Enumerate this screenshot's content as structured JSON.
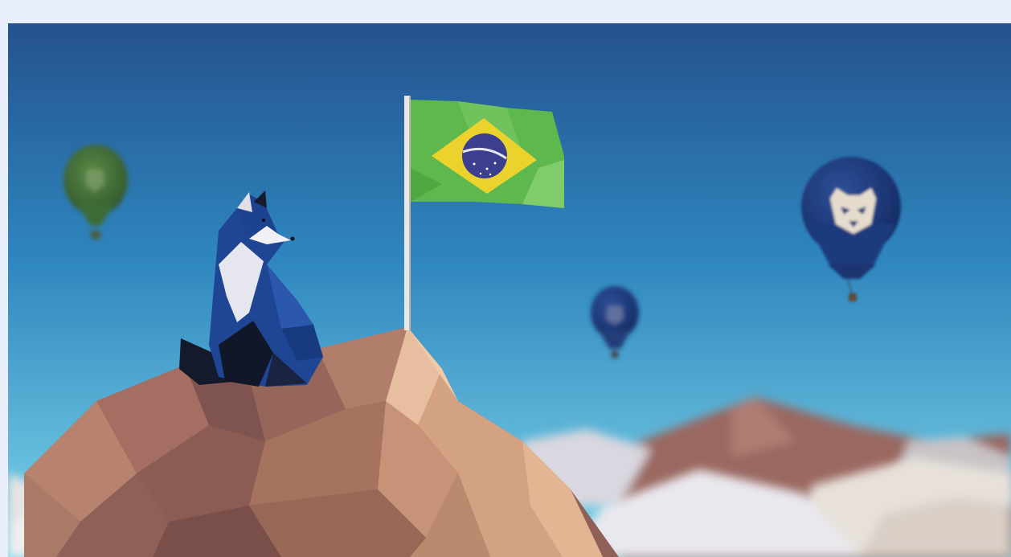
{
  "hero": {
    "colors": {
      "frame_background": "#e8effb",
      "sky_top": "#24528f",
      "sky_mid": "#2f87bf",
      "sky_bottom": "#7fd7ea",
      "fox_blue": "#1f4595",
      "fox_white": "#e6e6ee",
      "fox_dark": "#121a2c",
      "mountain_tan": "#d3a283",
      "mountain_brown": "#8f6058",
      "flag_green": "#5fb84d",
      "flag_yellow": "#ecd22c",
      "flag_blue": "#3c3e90",
      "balloon_green": "#3d6a36",
      "balloon_navy": "#1d3a7d"
    },
    "icons": {
      "flag": "brazil-flag",
      "mascot": "fox",
      "balloons": [
        "green-balloon",
        "small-navy-balloon",
        "large-navy-balloon"
      ]
    }
  }
}
